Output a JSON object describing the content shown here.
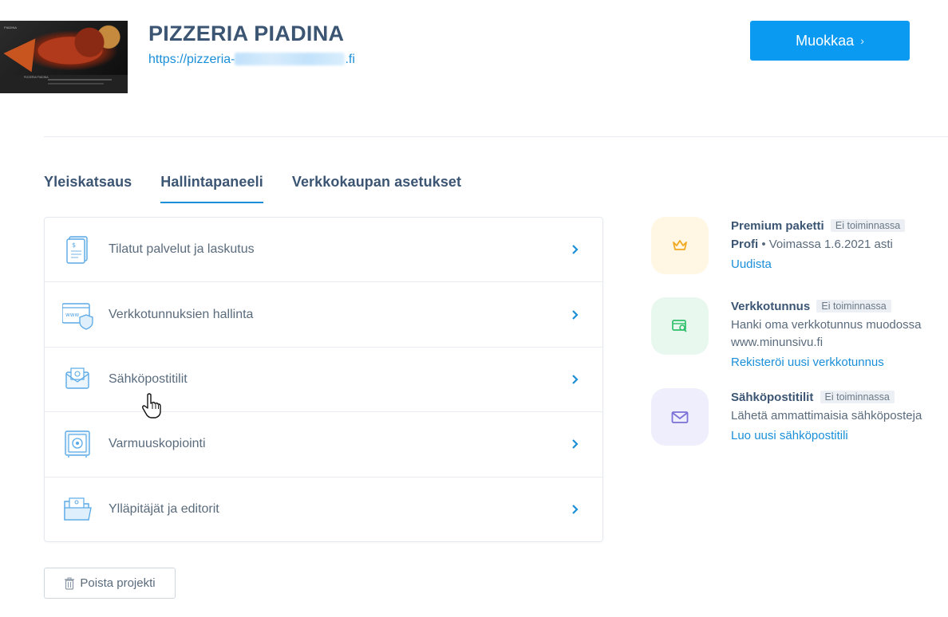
{
  "header": {
    "site_title": "PIZZERIA PIADINA",
    "url_prefix": "https://pizzeria-",
    "url_suffix": ".fi",
    "edit_label": "Muokkaa",
    "edit_icon": "chevron-right-icon",
    "thumbnail_brand": "PIADINA",
    "thumbnail_heading": "PIZZERIA PIADINA"
  },
  "tabs": [
    {
      "label": "Yleiskatsaus",
      "active": false
    },
    {
      "label": "Hallintapaneeli",
      "active": true
    },
    {
      "label": "Verkkokaupan asetukset",
      "active": false
    }
  ],
  "menu": [
    {
      "label": "Tilatut palvelut ja laskutus",
      "icon": "invoice-icon"
    },
    {
      "label": "Verkkotunnuksien hallinta",
      "icon": "domain-shield-icon"
    },
    {
      "label": "Sähköpostitilit",
      "icon": "email-icon"
    },
    {
      "label": "Varmuuskopiointi",
      "icon": "safe-icon"
    },
    {
      "label": "Ylläpitäjät ja editorit",
      "icon": "admin-folder-icon"
    }
  ],
  "features": [
    {
      "title": "Premium paketti",
      "status": "Ei toiminnassa",
      "desc_strong": "Profi",
      "desc": " • Voimassa 1.6.2021 asti",
      "link": "Uudista",
      "icon": "crown-icon",
      "bg": "#fff6e3",
      "color": "#f2a91f"
    },
    {
      "title": "Verkkotunnus",
      "status": "Ei toiminnassa",
      "desc": "Hanki oma verkkotunnus muodossa www.minunsivu.fi",
      "link": "Rekisteröi uusi verkkotunnus",
      "icon": "domain-search-icon",
      "bg": "#e8f8ef",
      "color": "#2fbf6a"
    },
    {
      "title": "Sähköpostitilit",
      "status": "Ei toiminnassa",
      "desc": "Lähetä ammattimaisia sähköposteja",
      "link": "Luo uusi sähköpostitili",
      "icon": "envelope-icon",
      "bg": "#eeeefc",
      "color": "#7b71d8"
    }
  ],
  "delete": {
    "label": "Poista projekti",
    "icon": "trash-icon"
  },
  "colors": {
    "accent": "#1a8fd8",
    "button": "#0b9af2",
    "title": "#3b5573"
  }
}
